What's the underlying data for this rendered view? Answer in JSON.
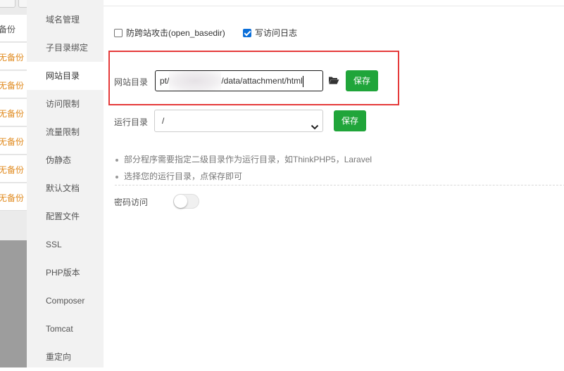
{
  "background_page": {
    "rows": [
      {
        "label": "备份",
        "tone": "normal"
      },
      {
        "label": "无备份",
        "tone": "orange"
      },
      {
        "label": "无备份",
        "tone": "orange"
      },
      {
        "label": "无备份",
        "tone": "orange"
      },
      {
        "label": "无备份",
        "tone": "orange"
      },
      {
        "label": "无备份",
        "tone": "orange"
      },
      {
        "label": "无备份",
        "tone": "orange"
      }
    ]
  },
  "sidebar": {
    "items": [
      {
        "label": "域名管理",
        "active": false
      },
      {
        "label": "子目录绑定",
        "active": false
      },
      {
        "label": "网站目录",
        "active": true
      },
      {
        "label": "访问限制",
        "active": false
      },
      {
        "label": "流量限制",
        "active": false
      },
      {
        "label": "伪静态",
        "active": false
      },
      {
        "label": "默认文档",
        "active": false
      },
      {
        "label": "配置文件",
        "active": false
      },
      {
        "label": "SSL",
        "active": false
      },
      {
        "label": "PHP版本",
        "active": false
      },
      {
        "label": "Composer",
        "active": false
      },
      {
        "label": "Tomcat",
        "active": false
      },
      {
        "label": "重定向",
        "active": false
      }
    ]
  },
  "options": {
    "open_basedir": {
      "label": "防跨站攻击(open_basedir)",
      "checked": false
    },
    "access_log": {
      "label": "写访问日志",
      "checked": true
    }
  },
  "site_dir": {
    "label": "网站目录",
    "value_prefix": "pt/",
    "value_suffix": "/data/attachment/html",
    "folder_icon": "folder-open-icon",
    "save_label": "保存"
  },
  "run_dir": {
    "label": "运行目录",
    "selected": "/",
    "save_label": "保存"
  },
  "tips": [
    "部分程序需要指定二级目录作为运行目录，如ThinkPHP5，Laravel",
    "选择您的运行目录，点保存即可"
  ],
  "password_access": {
    "label": "密码访问",
    "enabled": false
  },
  "colors": {
    "accent_green": "#20a53a",
    "highlight_red": "#e53a3a",
    "warning_orange": "#e08a1e"
  }
}
